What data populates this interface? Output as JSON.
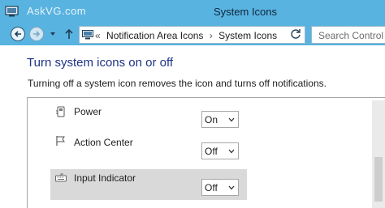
{
  "window": {
    "title": "System Icons",
    "watermark": "AskVG.com"
  },
  "navigation": {
    "breadcrumb_prefix": "«",
    "breadcrumb": [
      "Notification Area Icons",
      "System Icons"
    ],
    "breadcrumb_separator": "›",
    "search_placeholder": "Search Control Pan"
  },
  "main": {
    "heading": "Turn system icons on or off",
    "description": "Turning off a system icon removes the icon and turns off notifications.",
    "items": [
      {
        "label": "Power",
        "icon": "power-icon",
        "value": "On",
        "selected": false
      },
      {
        "label": "Action Center",
        "icon": "flag-icon",
        "value": "Off",
        "selected": false
      },
      {
        "label": "Input Indicator",
        "icon": "keyboard-icon",
        "value": "Off",
        "selected": true
      }
    ]
  },
  "colors": {
    "titlebar": "#58b3e0",
    "heading": "#1e3287",
    "selected_row": "#d9d9d9"
  }
}
